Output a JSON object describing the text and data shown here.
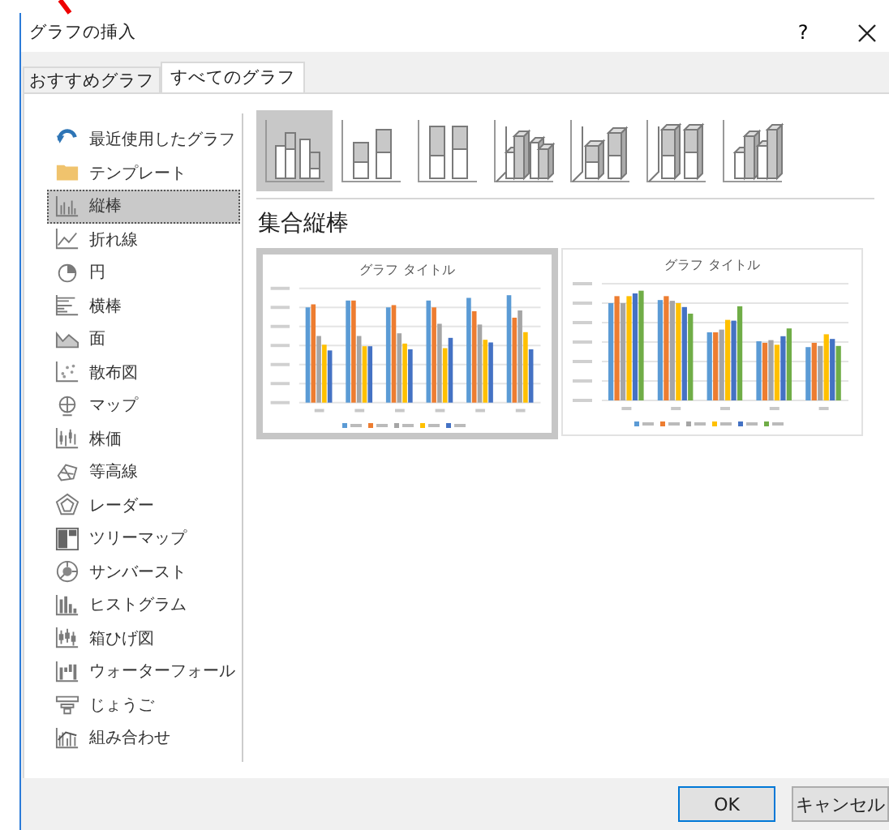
{
  "window": {
    "title": "グラフの挿入",
    "help": "?"
  },
  "tabs": [
    {
      "label": "おすすめグラフ",
      "selected": false
    },
    {
      "label": "すべてのグラフ",
      "selected": true
    }
  ],
  "sidebar": {
    "items": [
      {
        "label": "最近使用したグラフ",
        "selected": false
      },
      {
        "label": "テンプレート",
        "selected": false
      },
      {
        "label": "縦棒",
        "selected": true
      },
      {
        "label": "折れ線",
        "selected": false
      },
      {
        "label": "円",
        "selected": false
      },
      {
        "label": "横棒",
        "selected": false
      },
      {
        "label": "面",
        "selected": false
      },
      {
        "label": "散布図",
        "selected": false
      },
      {
        "label": "マップ",
        "selected": false
      },
      {
        "label": "株価",
        "selected": false
      },
      {
        "label": "等高線",
        "selected": false
      },
      {
        "label": "レーダー",
        "selected": false
      },
      {
        "label": "ツリーマップ",
        "selected": false
      },
      {
        "label": "サンバースト",
        "selected": false
      },
      {
        "label": "ヒストグラム",
        "selected": false
      },
      {
        "label": "箱ひげ図",
        "selected": false
      },
      {
        "label": "ウォーターフォール",
        "selected": false
      },
      {
        "label": "じょうご",
        "selected": false
      },
      {
        "label": "組み合わせ",
        "selected": false
      }
    ]
  },
  "subtypes": [
    {
      "selected": true
    },
    {
      "selected": false
    },
    {
      "selected": false
    },
    {
      "selected": false
    },
    {
      "selected": false
    },
    {
      "selected": false
    },
    {
      "selected": false
    }
  ],
  "subtype_name": "集合縦棒",
  "previews": [
    {
      "title": "グラフ タイトル",
      "selected": true
    },
    {
      "title": "グラフ タイトル",
      "selected": false
    }
  ],
  "buttons": [
    {
      "label": "OK",
      "default": true
    },
    {
      "label": "キャンセル",
      "default": false
    }
  ]
}
